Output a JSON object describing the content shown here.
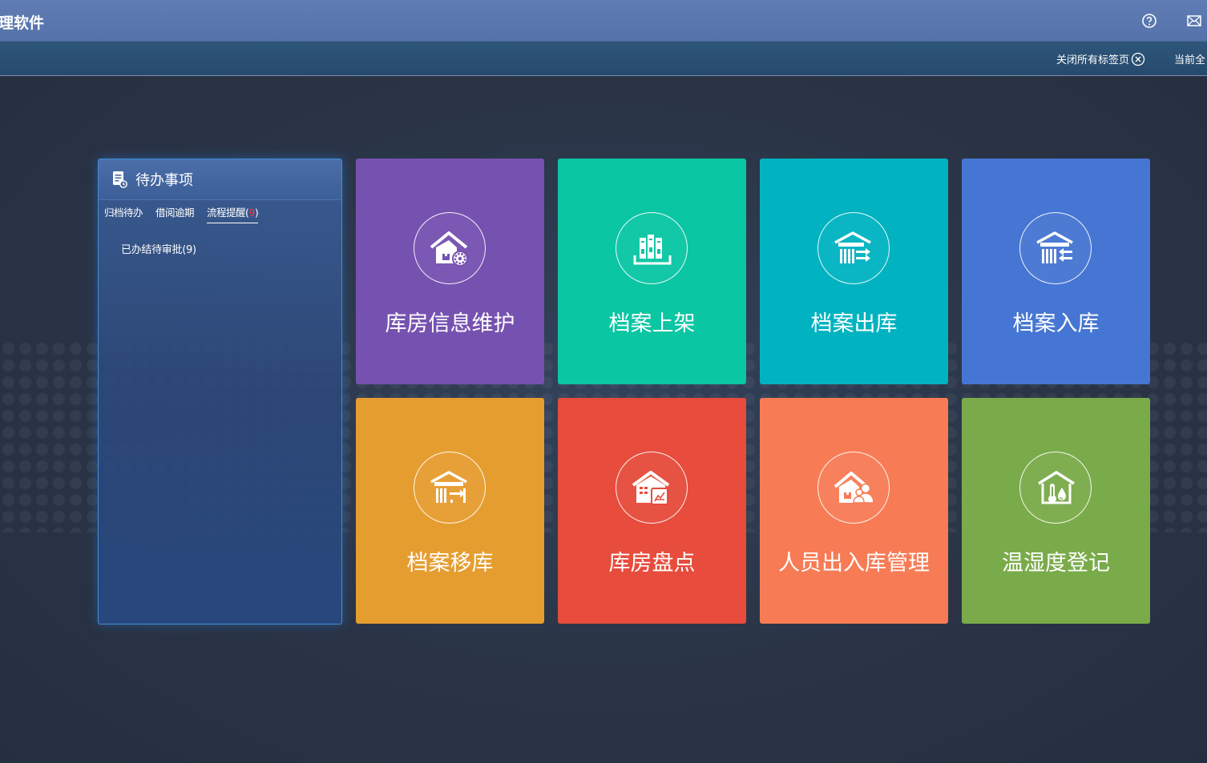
{
  "titlebar": {
    "app_title": "理软件"
  },
  "tabbar": {
    "close_all_tabs": "关闭所有标签页",
    "current_all": "当前全"
  },
  "todo": {
    "title": "待办事项",
    "tabs": [
      {
        "label": "归档待办",
        "badge": ""
      },
      {
        "label": "借阅逾期",
        "badge": ""
      },
      {
        "label": "流程提醒(",
        "badge": "9",
        "suffix": ")"
      }
    ],
    "items": [
      "已办结待审批(9)"
    ]
  },
  "tiles": [
    {
      "label": "库房信息维护",
      "color": "#7652b0",
      "icon": "house-gear-icon"
    },
    {
      "label": "档案上架",
      "color": "#0ac6a3",
      "icon": "bookshelf-icon"
    },
    {
      "label": "档案出库",
      "color": "#01b3c1",
      "icon": "warehouse-out-icon"
    },
    {
      "label": "档案入库",
      "color": "#4676d3",
      "icon": "warehouse-in-icon"
    },
    {
      "label": "档案移库",
      "color": "#e69d30",
      "icon": "warehouse-transfer-icon"
    },
    {
      "label": "库房盘点",
      "color": "#e74c3c",
      "icon": "inventory-chart-icon"
    },
    {
      "label": "人员出入库管理",
      "color": "#f77c56",
      "icon": "house-people-icon"
    },
    {
      "label": "温湿度登记",
      "color": "#7aab4a",
      "icon": "temperature-humidity-icon"
    }
  ]
}
